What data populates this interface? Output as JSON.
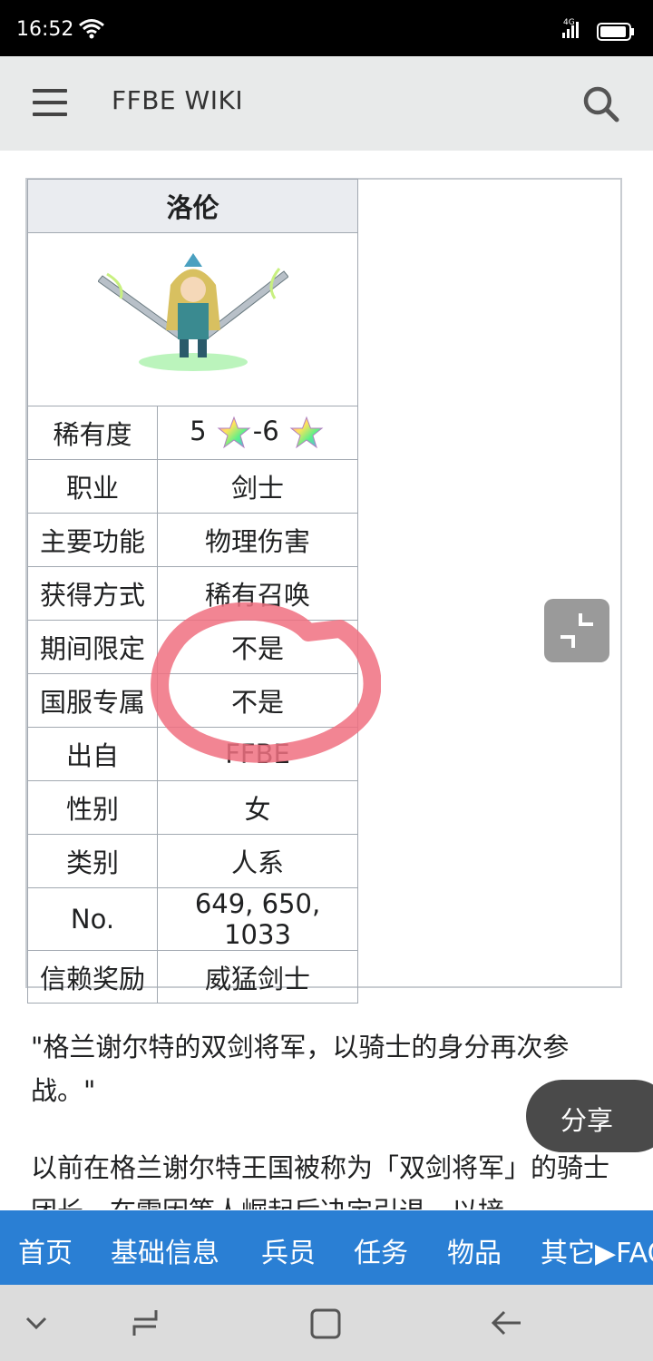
{
  "status_bar": {
    "time": "16:52",
    "network": "4G"
  },
  "header": {
    "title": "FFBE WIKI",
    "menu_icon": "hamburger-menu-icon",
    "search_icon": "search-icon"
  },
  "infobox": {
    "title": "洛伦",
    "rows": [
      {
        "label": "稀有度",
        "value_min": "5",
        "value_sep": "-6",
        "icon": "rainbow-star-icon"
      },
      {
        "label": "职业",
        "value": "剑士"
      },
      {
        "label": "主要功能",
        "value": "物理伤害"
      },
      {
        "label": "获得方式",
        "value": "稀有召唤"
      },
      {
        "label": "期间限定",
        "value": "不是"
      },
      {
        "label": "国服专属",
        "value": "不是"
      },
      {
        "label": "出自",
        "value": "FFBE"
      },
      {
        "label": "性别",
        "value": "女"
      },
      {
        "label": "类别",
        "value": "人系"
      },
      {
        "label": "No.",
        "value": "649, 650, 1033"
      },
      {
        "label": "信赖奖励",
        "value": "威猛剑士"
      }
    ]
  },
  "article": {
    "quote": "\"格兰谢尔特的双剑将军，以骑士的身分再次参战。\"",
    "paragraph": "以前在格兰谢尔特王国被称为「双剑将军」的骑士团长。在雷因等人崛起后决定引退，以接"
  },
  "share_button": {
    "label": "分享"
  },
  "bottom_nav": {
    "items": [
      "首页",
      "基础信息",
      "兵员",
      "任务",
      "物品",
      "其它▶FAQ"
    ]
  },
  "colors": {
    "header_bg": "#e8eaea",
    "nav_bg": "#2a7fd4",
    "annotation": "#f07080",
    "link_blue": "#3366cc",
    "link_red": "#dd3333"
  }
}
